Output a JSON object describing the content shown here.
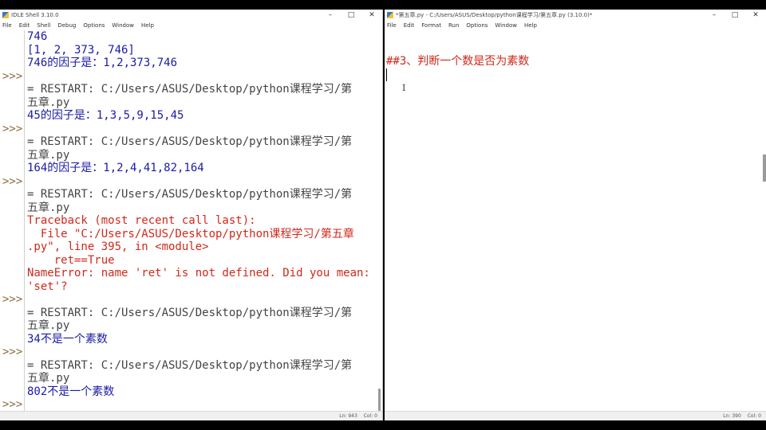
{
  "shell": {
    "title": "IDLE Shell 3.10.0",
    "menu": [
      "File",
      "Edit",
      "Shell",
      "Debug",
      "Options",
      "Window",
      "Help"
    ],
    "prompt_symbol": ">>>",
    "lines": [
      {
        "text": "746",
        "kind": "out"
      },
      {
        "text": "[1, 2, 373, 746]",
        "kind": "out"
      },
      {
        "text": "746的因子是：1,2,373,746",
        "kind": "out"
      },
      {
        "text": "",
        "kind": "prompt"
      },
      {
        "text": "= RESTART: C:/Users/ASUS/Desktop/python课程学习/第",
        "kind": "restart"
      },
      {
        "text": "五章.py",
        "kind": "restart"
      },
      {
        "text": "45的因子是：1,3,5,9,15,45",
        "kind": "out"
      },
      {
        "text": "",
        "kind": "prompt"
      },
      {
        "text": "= RESTART: C:/Users/ASUS/Desktop/python课程学习/第",
        "kind": "restart"
      },
      {
        "text": "五章.py",
        "kind": "restart"
      },
      {
        "text": "164的因子是：1,2,4,41,82,164",
        "kind": "out"
      },
      {
        "text": "",
        "kind": "prompt"
      },
      {
        "text": "= RESTART: C:/Users/ASUS/Desktop/python课程学习/第",
        "kind": "restart"
      },
      {
        "text": "五章.py",
        "kind": "restart"
      },
      {
        "text": "Traceback (most recent call last):",
        "kind": "err"
      },
      {
        "text": "  File \"C:/Users/ASUS/Desktop/python课程学习/第五章",
        "kind": "err"
      },
      {
        "text": ".py\", line 395, in <module>",
        "kind": "err"
      },
      {
        "text": "    ret==True",
        "kind": "err"
      },
      {
        "text": "NameError: name 'ret' is not defined. Did you mean:",
        "kind": "err"
      },
      {
        "text": "'set'?",
        "kind": "err"
      },
      {
        "text": "",
        "kind": "prompt"
      },
      {
        "text": "= RESTART: C:/Users/ASUS/Desktop/python课程学习/第",
        "kind": "restart"
      },
      {
        "text": "五章.py",
        "kind": "restart"
      },
      {
        "text": "34不是一个素数",
        "kind": "out"
      },
      {
        "text": "",
        "kind": "prompt"
      },
      {
        "text": "= RESTART: C:/Users/ASUS/Desktop/python课程学习/第",
        "kind": "restart"
      },
      {
        "text": "五章.py",
        "kind": "restart"
      },
      {
        "text": "802不是一个素数",
        "kind": "out"
      },
      {
        "text": "",
        "kind": "prompt"
      }
    ],
    "status": {
      "ln": "Ln: 943",
      "col": "Col: 0"
    }
  },
  "editor": {
    "title": "*第五章.py - C:/Users/ASUS/Desktop/python课程学习/第五章.py (3.10.0)*",
    "menu": [
      "File",
      "Edit",
      "Format",
      "Run",
      "Options",
      "Window",
      "Help"
    ],
    "code_lines": [
      "##3、判断一个数是否为素数"
    ],
    "status": {
      "ln": "Ln: 390",
      "col": "Col: 0"
    }
  },
  "colors": {
    "output": "#1a1aa6",
    "error": "#d0281b",
    "comment": "#d0281b",
    "prompt": "#8a6d3b"
  },
  "icons": [
    "idle-app-icon",
    "minimize-icon",
    "maximize-icon",
    "close-icon"
  ]
}
